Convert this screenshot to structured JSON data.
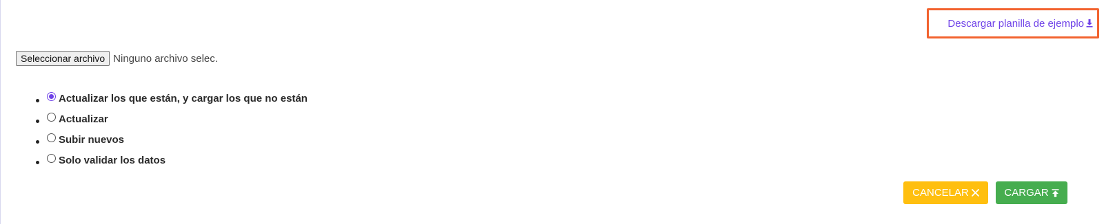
{
  "download": {
    "label": "Descargar planilla de ejemplo",
    "icon": "download-icon",
    "highlight_color": "#f2622e",
    "link_color": "#6f42e8"
  },
  "file": {
    "button_label": "Seleccionar archivo",
    "status": "Ninguno archivo selec."
  },
  "options": [
    {
      "label": "Actualizar los que están, y cargar los que no están",
      "selected": true
    },
    {
      "label": "Actualizar",
      "selected": false
    },
    {
      "label": "Subir nuevos",
      "selected": false
    },
    {
      "label": "Solo validar los datos",
      "selected": false
    }
  ],
  "actions": {
    "cancel": {
      "label": "CANCELAR",
      "icon": "close-icon",
      "color": "#ffbf0f"
    },
    "upload": {
      "label": "CARGAR",
      "icon": "upload-icon",
      "color": "#46ad4f"
    }
  }
}
